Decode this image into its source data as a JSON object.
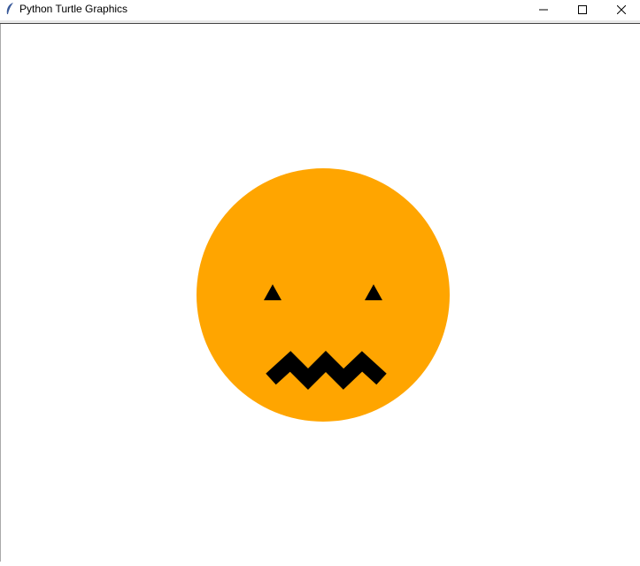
{
  "window": {
    "title": "Python Turtle Graphics"
  },
  "colors": {
    "face": "#ffa500",
    "features": "#000000"
  },
  "icons": {
    "app": "feather-icon",
    "minimize": "minimize-icon",
    "maximize": "maximize-icon",
    "close": "close-icon"
  }
}
